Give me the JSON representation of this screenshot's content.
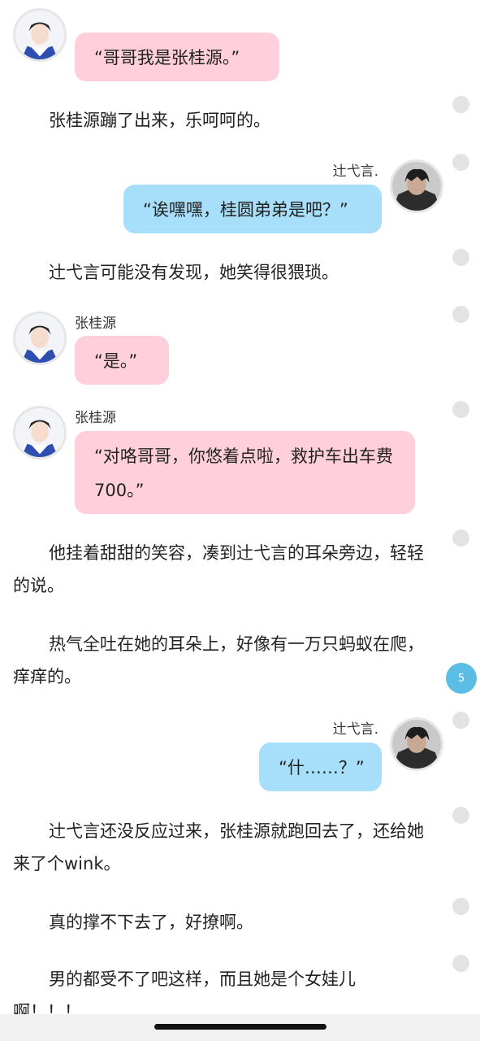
{
  "messages": {
    "m1": {
      "text": "“哥哥我是张桂源。”"
    },
    "p1": "张桂源蹦了出来，乐呵呵的。",
    "m2": {
      "speaker": "辻弋言.",
      "text": "“诶嘿嘿，桂圆弟弟是吧？”"
    },
    "p2": "辻弋言可能没有发现，她笑得很猥琐。",
    "m3": {
      "speaker": "张桂源",
      "text": "“是。”"
    },
    "m4": {
      "speaker": "张桂源",
      "text": "“对咯哥哥，你悠着点啦，救护车出车费700。”"
    },
    "p3": "他挂着甜甜的笑容，凑到辻弋言的耳朵旁边，轻轻的说。",
    "p4": "热气全吐在她的耳朵上，好像有一万只蚂蚁在爬，痒痒的。",
    "m5": {
      "speaker": "辻弋言.",
      "text": "“什……？”"
    },
    "p5": "辻弋言还没反应过来，张桂源就跑回去了，还给她来了个wink。",
    "p6": "真的撑不下去了，好撩啊。",
    "p7": "男的都受不了吧这样，而且她是个女娃儿啊！！！"
  },
  "comment_badge": "5",
  "colors": {
    "pink_bubble": "#ffd0dc",
    "blue_bubble": "#a7def9",
    "badge": "#5bbce4",
    "side_dot": "#e3e3e3"
  },
  "icons": {
    "avatar_zhang": "avatar-photo-icon",
    "avatar_yiyan": "avatar-photo-icon",
    "side_dot": "comment-dot-icon"
  }
}
